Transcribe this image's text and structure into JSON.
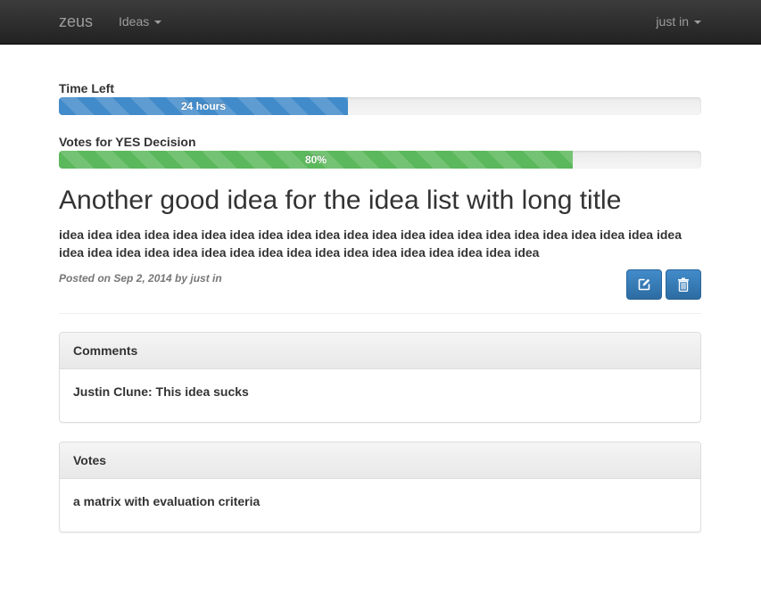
{
  "navbar": {
    "brand": "zeus",
    "ideas_menu": "Ideas",
    "user_menu": "just in"
  },
  "progress": {
    "time_left": {
      "label": "Time Left",
      "bar_text": "24 hours",
      "fill_percent": 45
    },
    "votes_yes": {
      "label": "Votes for YES Decision",
      "bar_text": "80%",
      "fill_percent": 80
    }
  },
  "idea": {
    "title": "Another good idea for the idea list with long title",
    "body": "idea idea idea idea idea idea idea idea idea idea idea idea idea idea idea idea idea idea idea idea idea idea idea idea idea idea idea idea idea idea idea idea idea idea idea idea idea idea idea",
    "posted": "Posted on Sep 2, 2014 by just in"
  },
  "actions": {
    "edit_icon": "edit-icon",
    "delete_icon": "trash-icon"
  },
  "comments": {
    "heading": "Comments",
    "items": [
      "Justin Clune: This idea sucks"
    ]
  },
  "votes": {
    "heading": "Votes",
    "items": [
      "a matrix with evaluation criteria"
    ]
  },
  "colors": {
    "navbar": "#222222",
    "primary": "#428bca",
    "success": "#5cb85c"
  }
}
